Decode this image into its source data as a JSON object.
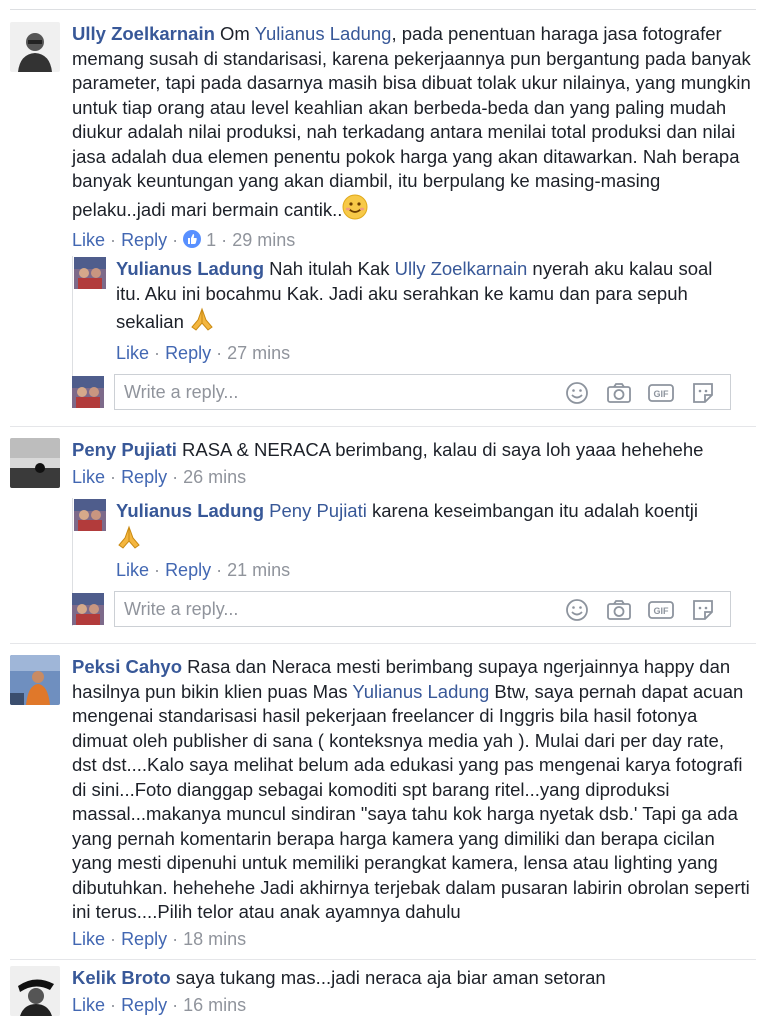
{
  "comments": [
    {
      "author": "Ully Zoelkarnain",
      "text_parts": [
        "Om ",
        "Yulianus Ladung",
        ", pada penentuan haraga jasa fotografer memang susah di standarisasi, karena pekerjaannya pun bergantung pada banyak parameter, tapi pada dasarnya masih bisa dibuat tolak ukur nilainya, yang mungkin untuk tiap orang atau level keahlian akan berbeda-beda dan yang paling mudah diukur adalah nilai produksi, nah terkadang antara menilai total produksi dan nilai jasa adalah dua elemen penentu pokok harga yang akan ditawarkan. Nah berapa banyak keuntungan yang akan diambil, itu berpulang ke masing-masing pelaku..jadi mari bermain cantik.."
      ],
      "like": "Like",
      "reply": "Reply",
      "reactions": "1",
      "time": "29 mins",
      "replies": [
        {
          "author": "Yulianus Ladung",
          "text_parts": [
            "Nah itulah Kak ",
            "Ully Zoelkarnain",
            " nyerah aku kalau soal itu. Aku ini bocahmu Kak. Jadi aku serahkan ke kamu dan para sepuh sekalian "
          ],
          "like": "Like",
          "reply": "Reply",
          "time": "27 mins"
        }
      ]
    },
    {
      "author": "Peny Pujiati",
      "text_parts": [
        "RASA & NERACA berimbang, kalau di saya loh yaaa hehehehe"
      ],
      "like": "Like",
      "reply": "Reply",
      "time": "26 mins",
      "replies": [
        {
          "author": "Yulianus Ladung",
          "text_parts": [
            "Peny Pujiati",
            " karena keseimbangan itu adalah koentji"
          ],
          "like": "Like",
          "reply": "Reply",
          "time": "21 mins"
        }
      ]
    },
    {
      "author": "Peksi Cahyo",
      "text_parts": [
        "Rasa dan Neraca mesti berimbang supaya ngerjainnya happy dan hasilnya pun bikin klien puas Mas ",
        "Yulianus Ladung",
        " Btw, saya pernah dapat acuan mengenai standarisasi hasil pekerjaan freelancer di Inggris bila hasil fotonya dimuat oleh publisher di sana ( konteksnya media yah ). Mulai dari per day rate, dst dst....Kalo saya melihat belum ada edukasi yang pas mengenai karya fotografi di sini...Foto dianggap sebagai komoditi spt barang ritel...yang diproduksi massal...makanya muncul sindiran \"saya tahu kok harga nyetak dsb.' Tapi ga ada yang pernah komentarin berapa harga kamera yang dimiliki dan berapa cicilan yang mesti dipenuhi untuk memiliki perangkat kamera, lensa atau lighting yang dibutuhkan. hehehehe Jadi akhirnya terjebak dalam pusaran labirin obrolan seperti ini terus....Pilih telor atau anak ayamnya dahulu"
      ],
      "like": "Like",
      "reply": "Reply",
      "time": "18 mins"
    },
    {
      "author": "Kelik Broto",
      "text_parts": [
        "saya tukang mas...jadi neraca aja biar aman setoran"
      ],
      "like": "Like",
      "reply": "Reply",
      "time": "16 mins"
    }
  ],
  "reply_box": {
    "placeholder": "Write a reply..."
  },
  "dot": "·",
  "icons": [
    "emoji-icon",
    "camera-icon",
    "gif-icon",
    "sticker-icon"
  ],
  "colors": {
    "link": "#385898",
    "action": "#4267b2",
    "meta": "#90949c"
  }
}
